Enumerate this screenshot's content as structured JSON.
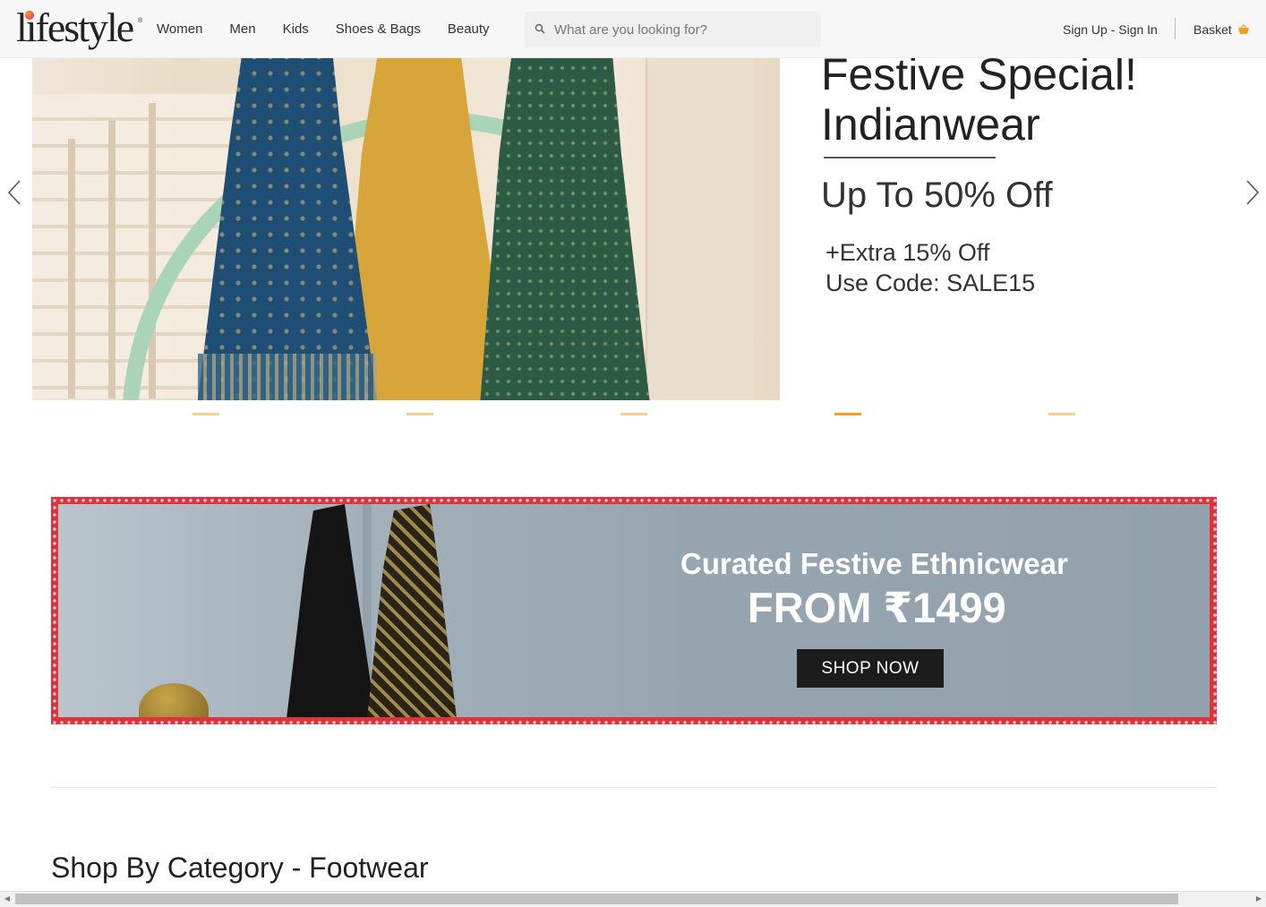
{
  "header": {
    "logo_text": "lifestyle",
    "nav": [
      {
        "label": "Women"
      },
      {
        "label": "Men"
      },
      {
        "label": "Kids"
      },
      {
        "label": "Shoes & Bags"
      },
      {
        "label": "Beauty"
      }
    ],
    "search": {
      "placeholder": "What are you looking for?",
      "value": ""
    },
    "signin_label": "Sign Up - Sign In",
    "basket_label": "Basket"
  },
  "hero": {
    "title_line1": "Festive Special!",
    "title_line2": "Indianwear",
    "offer": "Up To 50% Off",
    "extra_line1": "+Extra 15% Off",
    "extra_line2": "Use Code: SALE15",
    "slide_count": 5,
    "active_slide": 4
  },
  "promo": {
    "title": "Curated Festive Ethnicwear",
    "price": "FROM ₹1499",
    "button_label": "SHOP NOW"
  },
  "section": {
    "title": "Shop By Category - Footwear"
  },
  "colors": {
    "accent": "#f2a01e",
    "accent_light": "#f6d08a",
    "promo_border": "#e0323c",
    "button_dark": "#1c1c1c"
  }
}
